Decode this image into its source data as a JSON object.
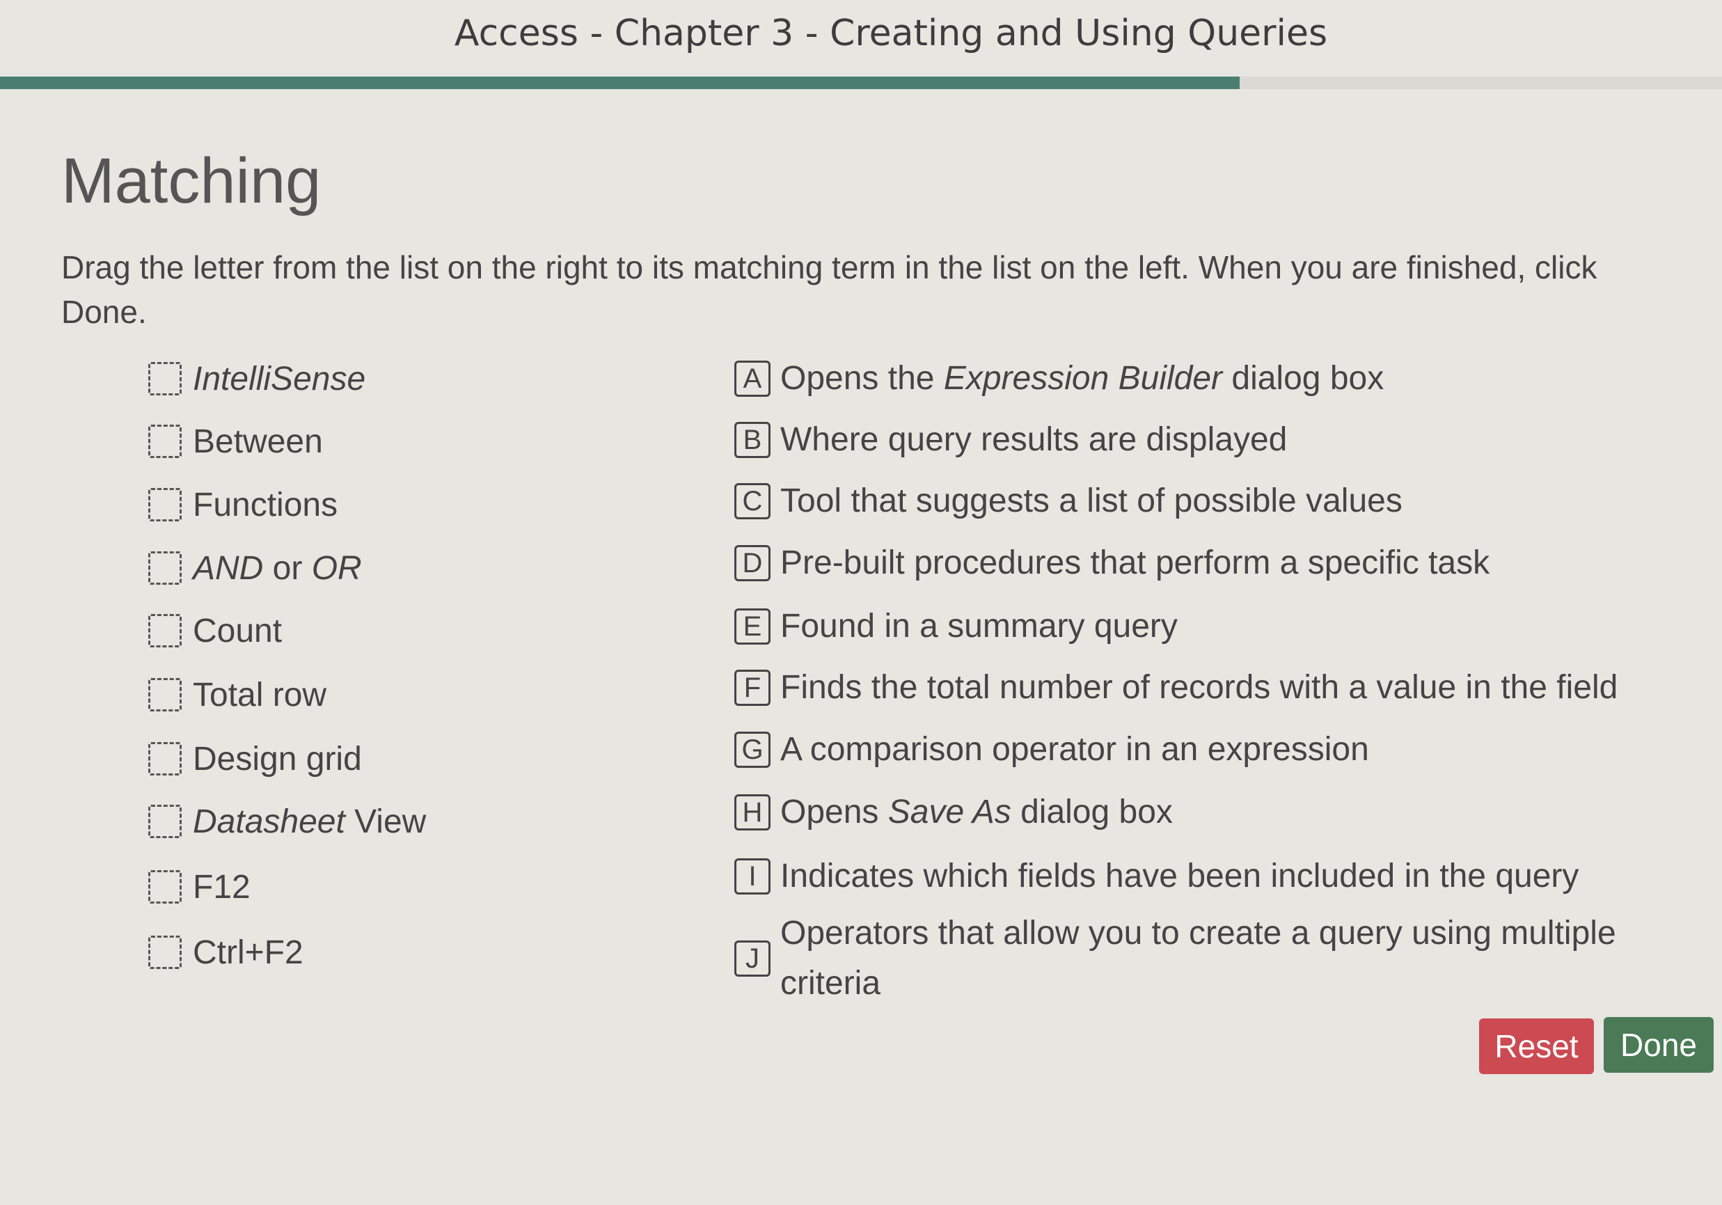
{
  "header": {
    "title": "Access - Chapter 3 - Creating and Using Queries",
    "progress_percent": 72
  },
  "main": {
    "heading": "Matching",
    "instructions": "Drag the letter from the list on the right to its matching term in the list on the left. When you are finished, click Done.",
    "terms": [
      {
        "parts": [
          {
            "text": "IntelliSense",
            "italic": true
          }
        ]
      },
      {
        "parts": [
          {
            "text": "Between",
            "italic": false
          }
        ]
      },
      {
        "parts": [
          {
            "text": "Functions",
            "italic": false
          }
        ]
      },
      {
        "parts": [
          {
            "text": "AND",
            "italic": true
          },
          {
            "text": " or ",
            "italic": false
          },
          {
            "text": "OR",
            "italic": true
          }
        ]
      },
      {
        "parts": [
          {
            "text": "Count",
            "italic": false
          }
        ]
      },
      {
        "parts": [
          {
            "text": "Total row",
            "italic": false
          }
        ]
      },
      {
        "parts": [
          {
            "text": "Design grid",
            "italic": false
          }
        ]
      },
      {
        "parts": [
          {
            "text": "Datasheet",
            "italic": true
          },
          {
            "text": " View",
            "italic": false
          }
        ]
      },
      {
        "parts": [
          {
            "text": "F12",
            "italic": false
          }
        ]
      },
      {
        "parts": [
          {
            "text": "Ctrl+F2",
            "italic": false
          }
        ]
      }
    ],
    "definitions": [
      {
        "letter": "A",
        "parts": [
          {
            "text": "Opens the ",
            "italic": false
          },
          {
            "text": "Expression Builder",
            "italic": true
          },
          {
            "text": " dialog box",
            "italic": false
          }
        ]
      },
      {
        "letter": "B",
        "parts": [
          {
            "text": "Where query results are displayed",
            "italic": false
          }
        ]
      },
      {
        "letter": "C",
        "parts": [
          {
            "text": "Tool that suggests a list of possible values",
            "italic": false
          }
        ]
      },
      {
        "letter": "D",
        "parts": [
          {
            "text": "Pre-built procedures that perform a specific task",
            "italic": false
          }
        ]
      },
      {
        "letter": "E",
        "parts": [
          {
            "text": "Found in a summary query",
            "italic": false
          }
        ]
      },
      {
        "letter": "F",
        "parts": [
          {
            "text": "Finds the total number of records with a value in the field",
            "italic": false
          }
        ]
      },
      {
        "letter": "G",
        "parts": [
          {
            "text": "A comparison operator in an expression",
            "italic": false
          }
        ]
      },
      {
        "letter": "H",
        "parts": [
          {
            "text": "Opens ",
            "italic": false
          },
          {
            "text": "Save As",
            "italic": true
          },
          {
            "text": " dialog box",
            "italic": false
          }
        ]
      },
      {
        "letter": "I",
        "parts": [
          {
            "text": "Indicates which fields have been included in the query",
            "italic": false
          }
        ]
      },
      {
        "letter": "J",
        "parts": [
          {
            "text": "Operators that allow you to create a query using multiple criteria",
            "italic": false
          }
        ]
      }
    ]
  },
  "buttons": {
    "reset_label": "Reset",
    "done_label": "Done"
  },
  "colors": {
    "background": "#e7e6e1",
    "progress": "#4b7e70",
    "reset": "#cc4a52",
    "done": "#4b7a56"
  }
}
